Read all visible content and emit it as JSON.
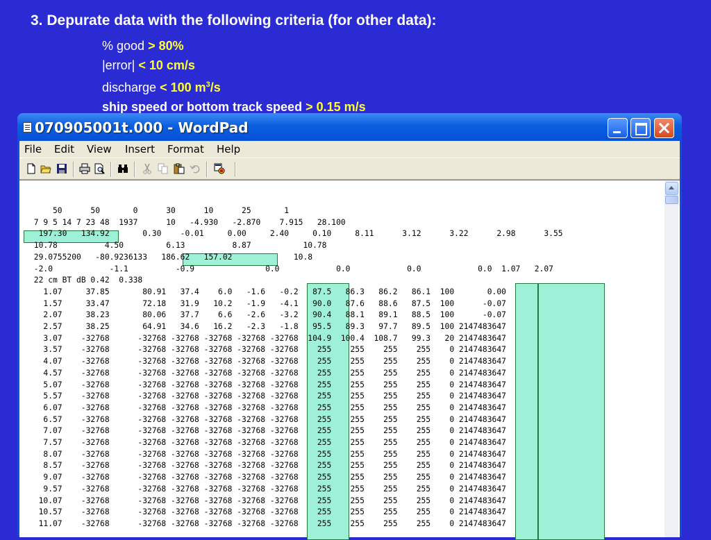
{
  "slide": {
    "title": "3. Depurate data with the following criteria (for other data):",
    "criteria": [
      {
        "label": "% good ",
        "value": "> 80%",
        "label_bold": false
      },
      {
        "label": "|error| ",
        "value": "< 10 cm/s",
        "label_bold": false
      },
      {
        "label": "discharge ",
        "value": "< 100 m",
        "sup": "3",
        "unit_after": "/s",
        "label_bold": false
      },
      {
        "label": "ship speed or bottom track speed ",
        "value": "> 0.15 m/s",
        "label_bold": true
      }
    ]
  },
  "window": {
    "title": "070905001t.000 - WordPad",
    "menu": [
      "File",
      "Edit",
      "View",
      "Insert",
      "Format",
      "Help"
    ],
    "toolbar_icons": [
      "new-document-icon",
      "open-folder-icon",
      "save-icon",
      "print-icon",
      "print-preview-icon",
      "find-icon",
      "cut-icon",
      "copy-icon",
      "paste-icon",
      "undo-icon",
      "insert-object-icon"
    ]
  },
  "document": {
    "lines": [
      "     50      50       0      30      10      25       1",
      " 7 9 5 14 7 23 48  1937      10   -4.930   -2.870    7.915   28.100",
      "  197.30   134.92       0.30    -0.01     0.00     2.40     0.10     8.11      3.12      3.22      2.98      3.55",
      " 10.78          4.50         6.13          8.87           10.78",
      " 29.0755200   -80.9236133   186.62   157.02             10.8",
      " -2.0            -1.1          -0.9               0.0            0.0            0.0            0.0  1.07   2.07",
      " 22 cm BT dB 0.42  0.338",
      "   1.07     37.85       80.91   37.4    6.0   -1.6   -0.2   87.5   86.3   86.2   86.1  100       0.00",
      "   1.57     33.47       72.18   31.9   10.2   -1.9   -4.1   90.0   87.6   88.6   87.5  100      -0.07",
      "   2.07     38.23       80.06   37.7    6.6   -2.6   -3.2   90.4   88.1   89.1   88.5  100      -0.07",
      "   2.57     38.25       64.91   34.6   16.2   -2.3   -1.8   95.5   89.3   97.7   89.5  100 2147483647",
      "   3.07    -32768      -32768 -32768 -32768 -32768 -32768  104.9  100.4  108.7   99.3   20 2147483647",
      "   3.57    -32768      -32768 -32768 -32768 -32768 -32768    255    255    255    255    0 2147483647",
      "   4.07    -32768      -32768 -32768 -32768 -32768 -32768    255    255    255    255    0 2147483647",
      "   4.57    -32768      -32768 -32768 -32768 -32768 -32768    255    255    255    255    0 2147483647",
      "   5.07    -32768      -32768 -32768 -32768 -32768 -32768    255    255    255    255    0 2147483647",
      "   5.57    -32768      -32768 -32768 -32768 -32768 -32768    255    255    255    255    0 2147483647",
      "   6.07    -32768      -32768 -32768 -32768 -32768 -32768    255    255    255    255    0 2147483647",
      "   6.57    -32768      -32768 -32768 -32768 -32768 -32768    255    255    255    255    0 2147483647",
      "   7.07    -32768      -32768 -32768 -32768 -32768 -32768    255    255    255    255    0 2147483647",
      "   7.57    -32768      -32768 -32768 -32768 -32768 -32768    255    255    255    255    0 2147483647",
      "   8.07    -32768      -32768 -32768 -32768 -32768 -32768    255    255    255    255    0 2147483647",
      "   8.57    -32768      -32768 -32768 -32768 -32768 -32768    255    255    255    255    0 2147483647",
      "   9.07    -32768      -32768 -32768 -32768 -32768 -32768    255    255    255    255    0 2147483647",
      "   9.57    -32768      -32768 -32768 -32768 -32768 -32768    255    255    255    255    0 2147483647",
      "  10.07    -32768      -32768 -32768 -32768 -32768 -32768    255    255    255    255    0 2147483647",
      "  10.57    -32768      -32768 -32768 -32768 -32768 -32768    255    255    255    255    0 2147483647",
      "  11.07    -32768      -32768 -32768 -32768 -32768 -32768    255    255    255    255    0 2147483647"
    ]
  },
  "colors": {
    "slide_background": "#2b2bd4",
    "criteria_value": "#ffff33",
    "highlight_fill": "#9ef0d6",
    "highlight_border": "#207a40"
  }
}
